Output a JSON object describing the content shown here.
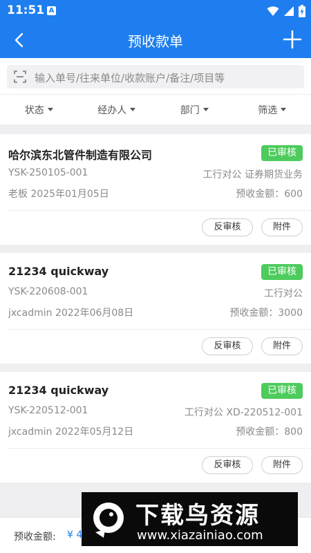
{
  "status_bar": {
    "time": "11:51",
    "notification_icon": "A"
  },
  "header": {
    "title": "预收款单",
    "back_icon": "back-arrow-icon",
    "add_icon": "plus-icon"
  },
  "search": {
    "placeholder": "输入单号/往来单位/收款账户/备注/项目等"
  },
  "filters": [
    {
      "label": "状态"
    },
    {
      "label": "经办人"
    },
    {
      "label": "部门"
    },
    {
      "label": "筛选"
    }
  ],
  "records": [
    {
      "company": "哈尔滨东北管件制造有限公司",
      "status": "已审核",
      "code": "YSK-250105-001",
      "account": "工行对公 证券期货业务",
      "handler_date": "老板 2025年01月05日",
      "amount": "预收金额：600",
      "unaudit_label": "反审核",
      "attach_label": "附件"
    },
    {
      "company": "21234 quickway",
      "status": "已审核",
      "code": "YSK-220608-001",
      "account": "工行对公",
      "handler_date": "jxcadmin 2022年06月08日",
      "amount": "预收金额：3000",
      "unaudit_label": "反审核",
      "attach_label": "附件"
    },
    {
      "company": "21234 quickway",
      "status": "已审核",
      "code": "YSK-220512-001",
      "account": "工行对公 XD-220512-001",
      "handler_date": "jxcadmin 2022年05月12日",
      "amount": "预收金额：800",
      "unaudit_label": "反审核",
      "attach_label": "附件"
    }
  ],
  "footer": {
    "total_label": "预收金额:",
    "total_value": "¥ 4"
  },
  "watermark": {
    "title": "下载鸟资源",
    "url": "www.xiazainiao.com"
  },
  "colors": {
    "primary": "#1e7ef0",
    "badge_green": "#4ecb5d"
  }
}
